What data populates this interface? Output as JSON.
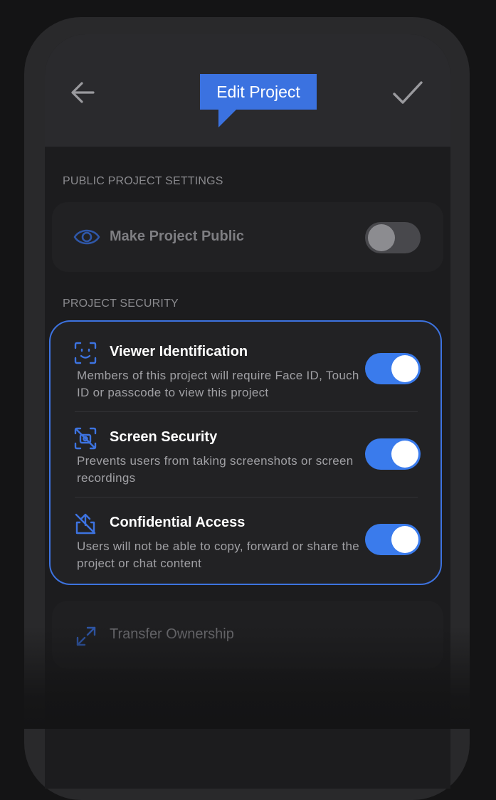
{
  "header": {
    "title": "Edit Project",
    "back_icon": "arrow-left-icon",
    "confirm_icon": "checkmark-icon"
  },
  "public_settings": {
    "section_label": "PUBLIC PROJECT SETTINGS",
    "make_public": {
      "icon": "eye-icon",
      "label": "Make Project Public",
      "enabled": false
    }
  },
  "security": {
    "section_label": "PROJECT SECURITY",
    "items": [
      {
        "icon": "face-id-icon",
        "title": "Viewer Identification",
        "description": "Members of this project will require Face ID, Touch ID or passcode to view this project",
        "enabled": true
      },
      {
        "icon": "screenshot-blocked-icon",
        "title": "Screen Security",
        "description": "Prevents users from taking screenshots or screen recordings",
        "enabled": true
      },
      {
        "icon": "share-blocked-icon",
        "title": "Confidential Access",
        "description": "Users will not be able to copy, forward or share the project or chat content",
        "enabled": true
      }
    ]
  },
  "transfer": {
    "icon": "transfer-arrows-icon",
    "label": "Transfer Ownership"
  },
  "colors": {
    "accent": "#3b72e0",
    "toggle_on": "#3a7bec",
    "background": "#1c1c1e"
  }
}
